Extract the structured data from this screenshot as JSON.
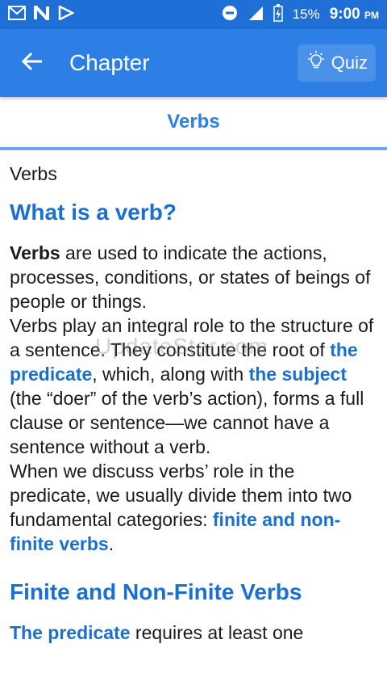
{
  "status_bar": {
    "battery": "15%",
    "time": "9:00",
    "ampm": "PM"
  },
  "app_bar": {
    "title": "Chapter",
    "quiz_label": "Quiz"
  },
  "section": {
    "title": "Verbs"
  },
  "article": {
    "plain_title": "Verbs",
    "heading1": "What is a verb?",
    "p1": {
      "bold": "Verbs",
      "text": " are used to indicate the actions, processes, conditions, or states of beings of people or things."
    },
    "p2": {
      "t1": "Verbs play an integral role to the structure of a sentence. They constitute the root of ",
      "link1": "the predicate",
      "t2": ", which, along with ",
      "link2": "the subject",
      "t3": " (the “doer” of the verb’s action), forms a full clause or sentence—we cannot have a sentence without a verb."
    },
    "p3": {
      "t1": "When we discuss verbs’ role in the predicate, we usually divide them into two fundamental categories: ",
      "link": "finite and non-finite verbs",
      "t2": "."
    },
    "heading2": "Finite and Non-Finite Verbs",
    "p4": {
      "link": "The predicate",
      "t1": " requires at least one"
    }
  },
  "watermark": "UpdateStar.com"
}
